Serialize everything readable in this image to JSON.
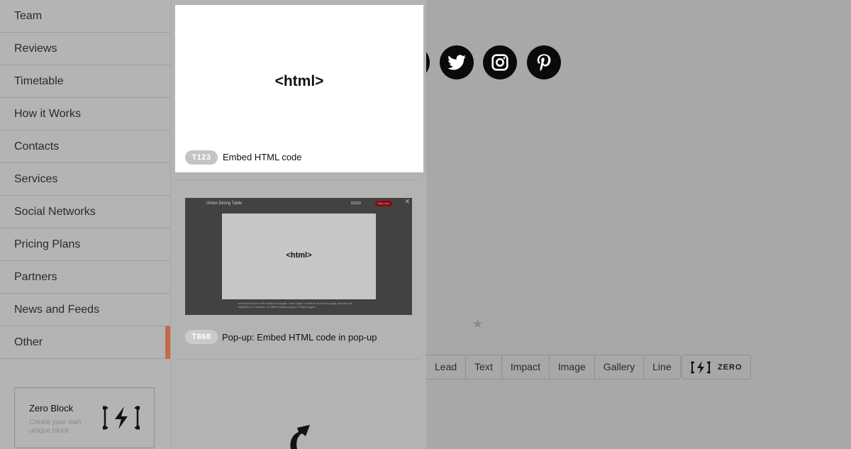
{
  "sidebar": {
    "items": [
      {
        "label": "Team",
        "active": false
      },
      {
        "label": "Reviews",
        "active": false
      },
      {
        "label": "Timetable",
        "active": false
      },
      {
        "label": "How it Works",
        "active": false
      },
      {
        "label": "Contacts",
        "active": false
      },
      {
        "label": "Services",
        "active": false
      },
      {
        "label": "Social Networks",
        "active": false
      },
      {
        "label": "Pricing Plans",
        "active": false
      },
      {
        "label": "Partners",
        "active": false
      },
      {
        "label": "News and Feeds",
        "active": false
      },
      {
        "label": "Other",
        "active": true
      }
    ],
    "zero_block": {
      "title": "Zero Block",
      "description": "Create your own unique block",
      "icon": "zero-block-icon"
    }
  },
  "templates": [
    {
      "code": "T123",
      "name": "Embed HTML code",
      "preview_text": "<html>"
    },
    {
      "code": "T868",
      "name": "Pop-up: Embed HTML code in pop-up",
      "preview_text": "<html>",
      "preview_header_title": "Union Dining Table",
      "preview_header_price": "$1000",
      "preview_header_button": "Buy now",
      "preview_footer_text": "sentence some of the random changes. Each page is created, but to this page can also be registered, re-shared, on offline display pages or blank pages."
    }
  ],
  "background": {
    "social_icons": [
      "twitter-icon",
      "instagram-icon",
      "pinterest-icon"
    ],
    "filters": [
      "Lead",
      "Text",
      "Impact",
      "Image",
      "Gallery",
      "Line"
    ],
    "zero_button_label": "ZERO"
  },
  "colors": {
    "accent": "#c8674a"
  }
}
